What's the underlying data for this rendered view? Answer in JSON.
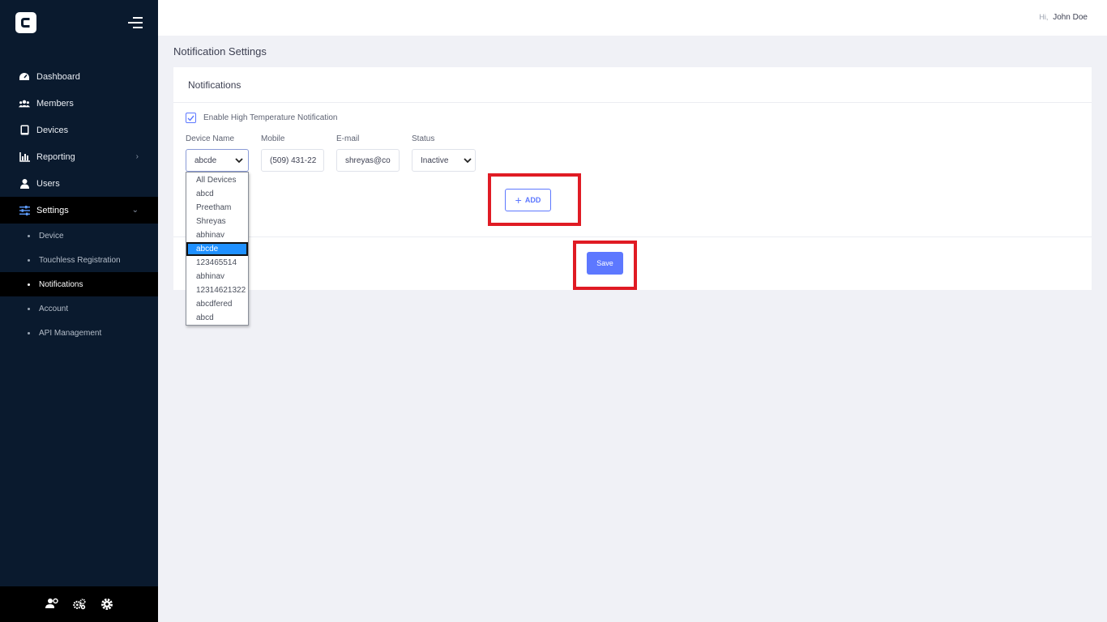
{
  "app": {
    "accent": "#5d78ff",
    "sidebar_bg": "#0a1a2e"
  },
  "sidebar": {
    "logo_icon": "brand-logo-icon",
    "menu_icon": "hamburger-icon",
    "items": [
      {
        "label": "Dashboard",
        "icon": "dashboard-icon"
      },
      {
        "label": "Members",
        "icon": "members-icon"
      },
      {
        "label": "Devices",
        "icon": "tablet-icon"
      },
      {
        "label": "Reporting",
        "icon": "chart-icon"
      },
      {
        "label": "Users",
        "icon": "user-icon"
      },
      {
        "label": "Settings",
        "icon": "sliders-icon"
      }
    ],
    "settings_sub": [
      {
        "label": "Device"
      },
      {
        "label": "Touchless Registration"
      },
      {
        "label": "Notifications"
      },
      {
        "label": "Account"
      },
      {
        "label": "API Management"
      }
    ],
    "footer_icons": [
      "user-settings-icon",
      "cogs-icon",
      "gear-icon"
    ]
  },
  "topbar": {
    "hi": "Hi,",
    "user_name": "John Doe"
  },
  "page": {
    "title": "Notification Settings"
  },
  "card": {
    "title": "Notifications",
    "checkbox_label": "Enable High Temperature Notification",
    "checkbox_checked": true,
    "labels": {
      "device": "Device Name",
      "mobile": "Mobile",
      "email": "E-mail",
      "status": "Status"
    },
    "values": {
      "device": "abcde",
      "mobile": "(509) 431-22",
      "email": "shreyas@co",
      "status": "Inactive"
    },
    "add_label": "ADD",
    "save_label": "Save"
  },
  "device_dropdown": {
    "options": [
      "All Devices",
      "abcd",
      "Preetham",
      "Shreyas",
      "abhinav",
      "abcde",
      "123465514",
      "abhinav",
      "12314621322",
      "abcdfered",
      "abcd"
    ],
    "selected_index": 5
  }
}
